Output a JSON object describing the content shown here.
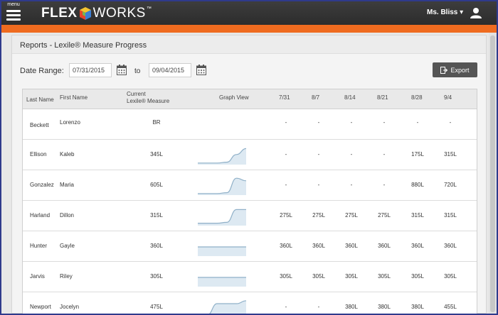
{
  "topbar": {
    "menu_label": "menu",
    "logo_flex": "FLEX",
    "logo_works": "WORKS",
    "logo_tm": "™",
    "user_name": "Ms. Bliss ▾",
    "colors": {
      "bar": "#2c2c2c",
      "accent": "#ef6b1f"
    }
  },
  "panel": {
    "title": "Reports - Lexile® Measure Progress",
    "date_range_label": "Date Range:",
    "start_date": "07/31/2015",
    "to_label": "to",
    "end_date": "09/04/2015",
    "export_label": "Export"
  },
  "table": {
    "headers": {
      "last_name": "Last Name",
      "first_name": "First Name",
      "current_line1": "Current",
      "current_line2": "Lexile® Measure",
      "graph_view": "Graph View",
      "dates": [
        "7/31",
        "8/7",
        "8/14",
        "8/21",
        "8/28",
        "9/4"
      ]
    },
    "rows": [
      {
        "last": "Beckett",
        "first": "Lorenzo",
        "current": "BR",
        "values": [
          "-",
          "-",
          "-",
          "-",
          "-",
          "-"
        ],
        "trend": []
      },
      {
        "last": "Ellison",
        "first": "Kaleb",
        "current": "345L",
        "values": [
          "-",
          "-",
          "-",
          "-",
          "175L",
          "315L"
        ],
        "trend": [
          0.05,
          0.05,
          0.05,
          0.1,
          0.55,
          0.9
        ]
      },
      {
        "last": "Gonzalez",
        "first": "Maria",
        "current": "605L",
        "values": [
          "-",
          "-",
          "-",
          "-",
          "880L",
          "720L"
        ],
        "trend": [
          0.05,
          0.05,
          0.05,
          0.1,
          0.95,
          0.8
        ]
      },
      {
        "last": "Harland",
        "first": "Dillon",
        "current": "315L",
        "values": [
          "275L",
          "275L",
          "275L",
          "275L",
          "315L",
          "315L"
        ],
        "trend": [
          0.1,
          0.1,
          0.1,
          0.15,
          0.9,
          0.9
        ]
      },
      {
        "last": "Hunter",
        "first": "Gayle",
        "current": "360L",
        "values": [
          "360L",
          "360L",
          "360L",
          "360L",
          "360L",
          "360L"
        ],
        "trend": [
          0.5,
          0.5,
          0.5,
          0.5,
          0.5,
          0.5
        ]
      },
      {
        "last": "Jarvis",
        "first": "Riley",
        "current": "305L",
        "values": [
          "305L",
          "305L",
          "305L",
          "305L",
          "305L",
          "305L"
        ],
        "trend": [
          0.5,
          0.5,
          0.5,
          0.5,
          0.5,
          0.5
        ]
      },
      {
        "last": "Newport",
        "first": "Jocelyn",
        "current": "475L",
        "values": [
          "-",
          "-",
          "380L",
          "380L",
          "380L",
          "455L"
        ],
        "trend": [
          0.05,
          0.1,
          0.75,
          0.75,
          0.75,
          0.92
        ]
      }
    ]
  }
}
